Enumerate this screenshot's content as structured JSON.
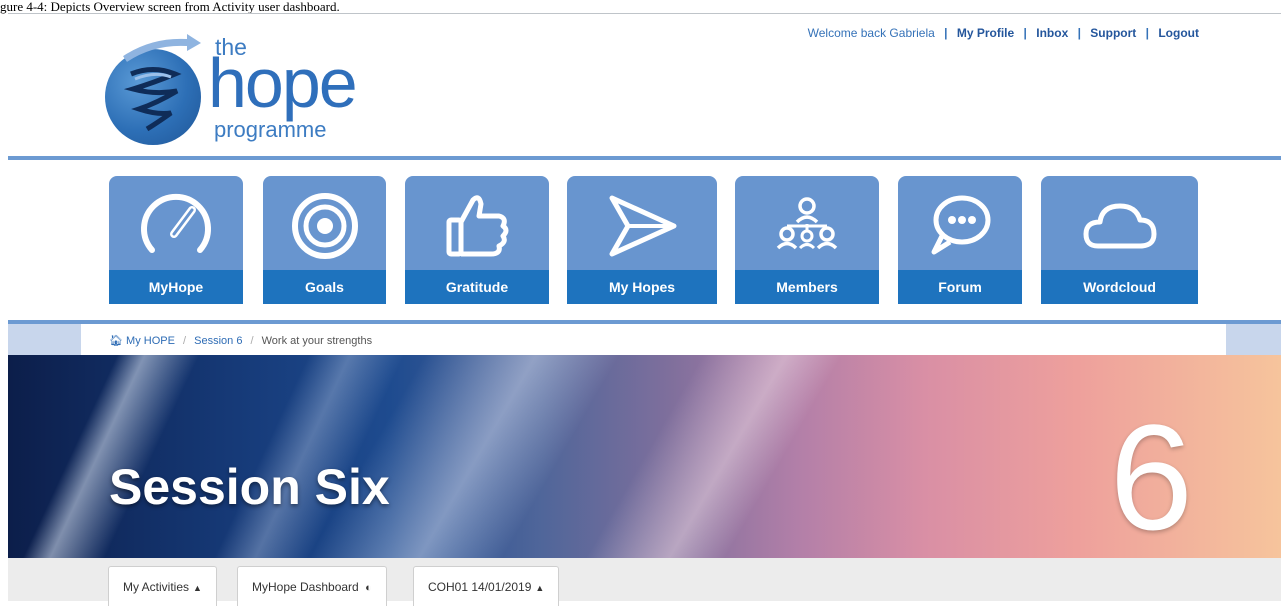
{
  "caption": "gure 4-4: Depicts Overview screen from Activity user dashboard.",
  "logo": {
    "line1": "the",
    "line2": "hope",
    "line3": "programme"
  },
  "userbar": {
    "welcome": "Welcome back Gabriela",
    "links": [
      "My Profile",
      "Inbox",
      "Support",
      "Logout"
    ]
  },
  "nav": {
    "tiles": [
      {
        "label": "MyHope",
        "icon": "speedometer-icon"
      },
      {
        "label": "Goals",
        "icon": "target-icon"
      },
      {
        "label": "Gratitude",
        "icon": "thumbs-up-icon"
      },
      {
        "label": "My Hopes",
        "icon": "paper-plane-icon"
      },
      {
        "label": "Members",
        "icon": "members-network-icon"
      },
      {
        "label": "Forum",
        "icon": "chat-bubbles-icon"
      },
      {
        "label": "Wordcloud",
        "icon": "cloud-icon"
      }
    ]
  },
  "breadcrumb": {
    "home": "My HOPE",
    "session": "Session 6",
    "current": "Work at your strengths"
  },
  "banner": {
    "title": "Session Six",
    "number": "6"
  },
  "toolbar": {
    "activities": "My Activities",
    "dashboard": "MyHope Dashboard",
    "cohort": "COH01 14/01/2019"
  },
  "colors": {
    "accent": "#1e73be",
    "tile": "#6895cf",
    "rule": "#6c9ad2"
  }
}
